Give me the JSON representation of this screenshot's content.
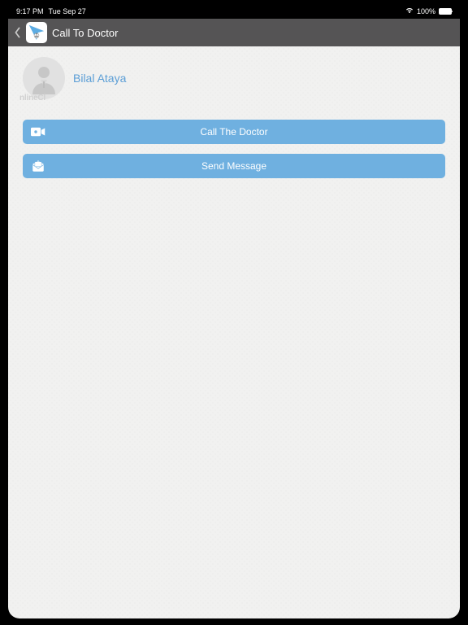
{
  "status": {
    "time": "9:17 PM",
    "date": "Tue Sep 27",
    "battery_pct": "100%"
  },
  "nav": {
    "title": "Call To Doctor"
  },
  "profile": {
    "name": "Bilal Ataya",
    "watermark": "nlineCl"
  },
  "buttons": {
    "call": "Call The Doctor",
    "message": "Send Message"
  }
}
